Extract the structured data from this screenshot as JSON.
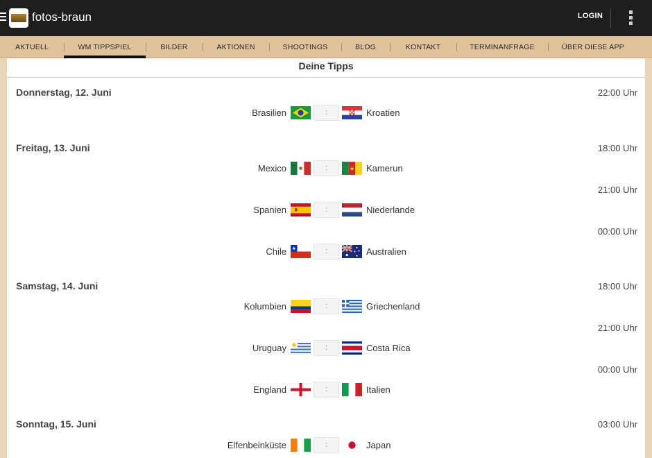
{
  "appbar": {
    "title": "fotos-braun",
    "login_label": "LOGIN",
    "icons": {
      "menu": "hamburger-icon",
      "logo": "fotos-braun-logo",
      "overflow": "more-vert-icon"
    }
  },
  "tabs": [
    {
      "label": "AKTUELL",
      "active": false
    },
    {
      "label": "WM TIPPSPIEL",
      "active": true
    },
    {
      "label": "BILDER",
      "active": false
    },
    {
      "label": "AKTIONEN",
      "active": false
    },
    {
      "label": "SHOOTINGS",
      "active": false
    },
    {
      "label": "BLOG",
      "active": false
    },
    {
      "label": "KONTAKT",
      "active": false
    },
    {
      "label": "TERMINANFRAGE",
      "active": false
    },
    {
      "label": "ÜBER DIESE APP",
      "active": false
    }
  ],
  "main": {
    "title": "Deine Tipps",
    "score_separator": ":",
    "days": [
      {
        "title": "Donnerstag, 12. Juni",
        "matches": [
          {
            "time": "22:00 Uhr",
            "home": "Brasilien",
            "away": "Kroatien",
            "home_flag": "brazil-flag",
            "away_flag": "croatia-flag"
          }
        ]
      },
      {
        "title": "Freitag, 13. Juni",
        "matches": [
          {
            "time": "18:00 Uhr",
            "home": "Mexico",
            "away": "Kamerun",
            "home_flag": "mexico-flag",
            "away_flag": "cameroon-flag"
          },
          {
            "time": "21:00 Uhr",
            "home": "Spanien",
            "away": "Niederlande",
            "home_flag": "spain-flag",
            "away_flag": "netherlands-flag"
          },
          {
            "time": "00:00 Uhr",
            "home": "Chile",
            "away": "Australien",
            "home_flag": "chile-flag",
            "away_flag": "australia-flag"
          }
        ]
      },
      {
        "title": "Samstag, 14. Juni",
        "matches": [
          {
            "time": "18:00 Uhr",
            "home": "Kolumbien",
            "away": "Griechenland",
            "home_flag": "colombia-flag",
            "away_flag": "greece-flag"
          },
          {
            "time": "21:00 Uhr",
            "home": "Uruguay",
            "away": "Costa Rica",
            "home_flag": "uruguay-flag",
            "away_flag": "costa-rica-flag"
          },
          {
            "time": "00:00 Uhr",
            "home": "England",
            "away": "Italien",
            "home_flag": "england-flag",
            "away_flag": "italy-flag"
          }
        ]
      },
      {
        "title": "Sonntag, 15. Juni",
        "matches": [
          {
            "time": "03:00 Uhr",
            "home": "Elfenbeinküste",
            "away": "Japan",
            "home_flag": "ivory-coast-flag",
            "away_flag": "japan-flag"
          }
        ]
      }
    ]
  },
  "colors": {
    "appbar_bg": "#1e1e1e",
    "tabbar_bg": "#e0c29a",
    "page_bg": "#e8d5b9",
    "card_bg": "#ffffff",
    "active_tab_indicator": "#111111"
  }
}
